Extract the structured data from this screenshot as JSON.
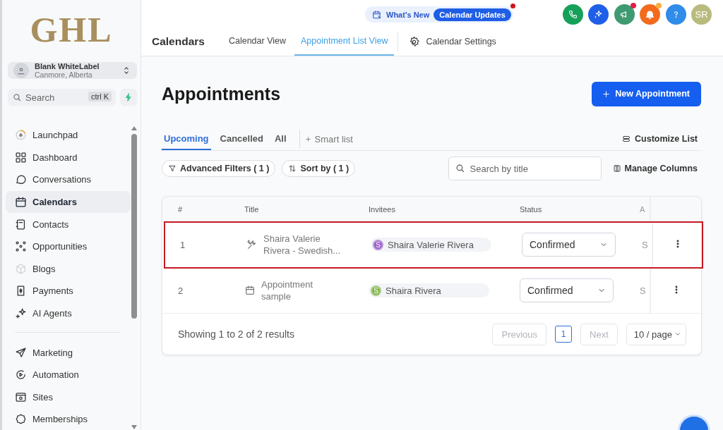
{
  "logo": {
    "text": "GHL"
  },
  "account": {
    "name": "Blank WhiteLabel",
    "location": "Canmore, Alberta"
  },
  "search": {
    "placeholder": "Search",
    "shortcut": "ctrl K"
  },
  "sidebar": {
    "items": [
      {
        "label": "Launchpad",
        "selected": false
      },
      {
        "label": "Dashboard",
        "selected": false
      },
      {
        "label": "Conversations",
        "selected": false
      },
      {
        "label": "Calendars",
        "selected": true
      },
      {
        "label": "Contacts",
        "selected": false
      },
      {
        "label": "Opportunities",
        "selected": false
      },
      {
        "label": "Blogs",
        "selected": false
      },
      {
        "label": "Payments",
        "selected": false
      },
      {
        "label": "AI Agents",
        "selected": false
      }
    ],
    "items_2": [
      {
        "label": "Marketing",
        "selected": false
      },
      {
        "label": "Automation",
        "selected": false
      },
      {
        "label": "Sites",
        "selected": false
      },
      {
        "label": "Memberships",
        "selected": false
      }
    ]
  },
  "announcement": {
    "label": "What's New",
    "badge": "Calendar Updates",
    "dot": true
  },
  "toolbar": {
    "buttons": [
      {
        "kind": "phone",
        "color": "#17a05a",
        "badge": false
      },
      {
        "kind": "sparkle",
        "color": "#1f5ee6",
        "badge": false
      },
      {
        "kind": "megaphone",
        "color": "#3f9a72",
        "badge": true
      },
      {
        "kind": "bell",
        "color": "#f26b1d",
        "badge": true
      },
      {
        "kind": "help",
        "color": "#2f8ce8",
        "badge": false
      }
    ],
    "avatar": {
      "initials": "SR",
      "color": "#b9ba7e"
    }
  },
  "header": {
    "title": "Calendars",
    "tabs": [
      {
        "label": "Calendar View",
        "selected": false
      },
      {
        "label": "Appointment List View",
        "selected": true
      }
    ],
    "settings": "Calendar Settings"
  },
  "page": {
    "title": "Appointments",
    "new_button": "New Appointment"
  },
  "list_tabs": [
    {
      "label": "Upcoming",
      "selected": true
    },
    {
      "label": "Cancelled",
      "selected": false
    },
    {
      "label": "All",
      "selected": false
    }
  ],
  "smart_list": "Smart list",
  "customize": "Customize List",
  "filters": {
    "advanced": "Advanced Filters ( 1 )",
    "sort": "Sort by ( 1 )",
    "search_placeholder": "Search by title",
    "manage_columns": "Manage Columns"
  },
  "table": {
    "columns": [
      "#",
      "Title",
      "Invitees",
      "Status",
      "A"
    ],
    "rows": [
      {
        "number": "1",
        "kind": "tools",
        "title": "Shaira Valerie Rivera - Swedish...",
        "invitee": "Shaira Valerie Rivera",
        "initial": "S",
        "color": "#9a62c9",
        "status": "Confirmed",
        "column_5": "S",
        "highlighted": true
      },
      {
        "number": "2",
        "kind": "calendar",
        "title": "Appointment sample",
        "invitee": "Shaira Rivera",
        "initial": "S",
        "color": "#86b552",
        "status": "Confirmed",
        "column_5": "S",
        "highlighted": false
      }
    ]
  },
  "pagination": {
    "summary": "Showing 1 to 2 of 2 results",
    "previous": "Previous",
    "page": "1",
    "next": "Next",
    "page_size": "10 / page"
  }
}
